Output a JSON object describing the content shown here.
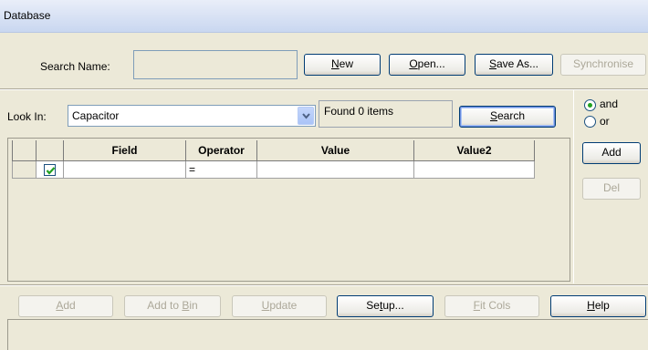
{
  "title": "Database",
  "search_name": {
    "label": "Search Name:",
    "value": "",
    "buttons": {
      "new": {
        "pre": "",
        "key": "N",
        "post": "ew"
      },
      "open": {
        "pre": "",
        "key": "O",
        "post": "pen..."
      },
      "save_as": {
        "pre": "",
        "key": "S",
        "post": "ave As..."
      },
      "synchronise": "Synchronise"
    }
  },
  "look_in": {
    "label": "Look In:",
    "value": "Capacitor",
    "found_text": "Found 0 items",
    "search_button": {
      "pre": "",
      "key": "S",
      "post": "earch"
    }
  },
  "logic": {
    "and_label": "and",
    "or_label": "or",
    "selected": "and",
    "add_label": "Add",
    "del_label": "Del"
  },
  "grid": {
    "columns": [
      "Field",
      "Operator",
      "Value",
      "Value2"
    ],
    "rows": [
      {
        "checked": true,
        "field": "",
        "operator": "=",
        "value": "",
        "value2": ""
      }
    ]
  },
  "bottom_buttons": {
    "add": {
      "pre": "",
      "key": "A",
      "post": "dd"
    },
    "add_to_bin": {
      "pre": "Add to ",
      "key": "B",
      "post": "in"
    },
    "update": {
      "pre": "",
      "key": "U",
      "post": "pdate"
    },
    "setup": {
      "pre": "Se",
      "key": "t",
      "post": "up..."
    },
    "fit_cols": {
      "pre": "",
      "key": "F",
      "post": "it Cols"
    },
    "help": {
      "pre": "",
      "key": "H",
      "post": "elp"
    }
  },
  "colors": {
    "title_bar": "#c9d7f0",
    "background": "#ece9d8",
    "radio_dot": "#21a121",
    "checkbox_tick": "#21a121"
  }
}
